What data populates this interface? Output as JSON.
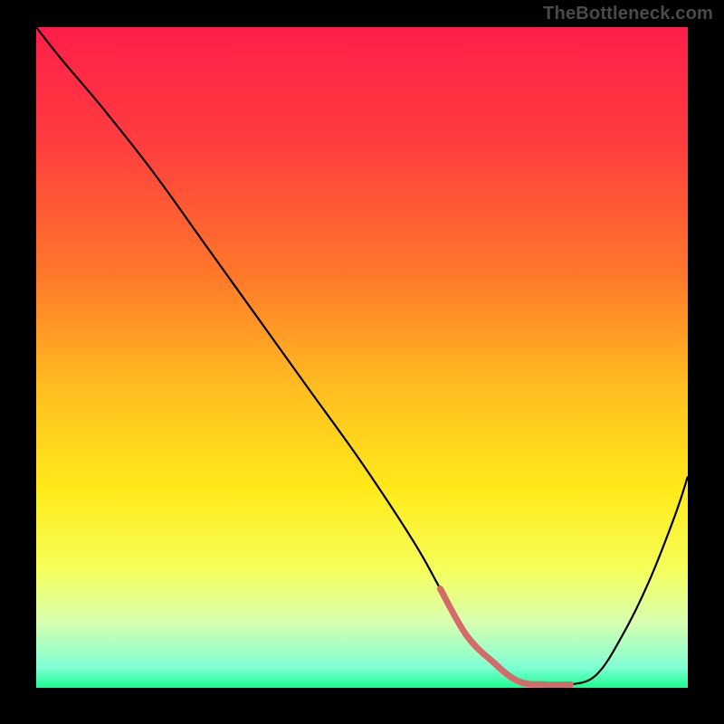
{
  "watermark": "TheBottleneck.com",
  "chart_data": {
    "type": "line",
    "title": "",
    "xlabel": "",
    "ylabel": "",
    "xlim": [
      0,
      100
    ],
    "ylim": [
      0,
      100
    ],
    "gradient_stops": [
      {
        "offset": 0,
        "color": "#ff1e4a"
      },
      {
        "offset": 18,
        "color": "#ff3e3e"
      },
      {
        "offset": 38,
        "color": "#ff7a2a"
      },
      {
        "offset": 55,
        "color": "#ffbf20"
      },
      {
        "offset": 70,
        "color": "#ffea1a"
      },
      {
        "offset": 82,
        "color": "#f6ff5a"
      },
      {
        "offset": 90,
        "color": "#d8ffb0"
      },
      {
        "offset": 97,
        "color": "#7effd4"
      },
      {
        "offset": 100,
        "color": "#18ff8e"
      }
    ],
    "series": [
      {
        "name": "curve",
        "color": "#000000",
        "x": [
          0,
          4,
          10,
          18,
          26,
          34,
          42,
          50,
          58,
          62,
          66,
          70,
          74,
          78,
          82,
          86,
          90,
          94,
          98,
          100
        ],
        "y": [
          100,
          95,
          88,
          78,
          67,
          56,
          45,
          34,
          22,
          15,
          8,
          4,
          1,
          0.5,
          0.5,
          2,
          8,
          16,
          26,
          32
        ]
      },
      {
        "name": "highlight",
        "color": "#d46a6a",
        "x": [
          62,
          66,
          70,
          74,
          78,
          82
        ],
        "y": [
          15,
          8,
          4,
          1,
          0.5,
          0.5
        ]
      }
    ],
    "highlight_thickness": 7
  }
}
